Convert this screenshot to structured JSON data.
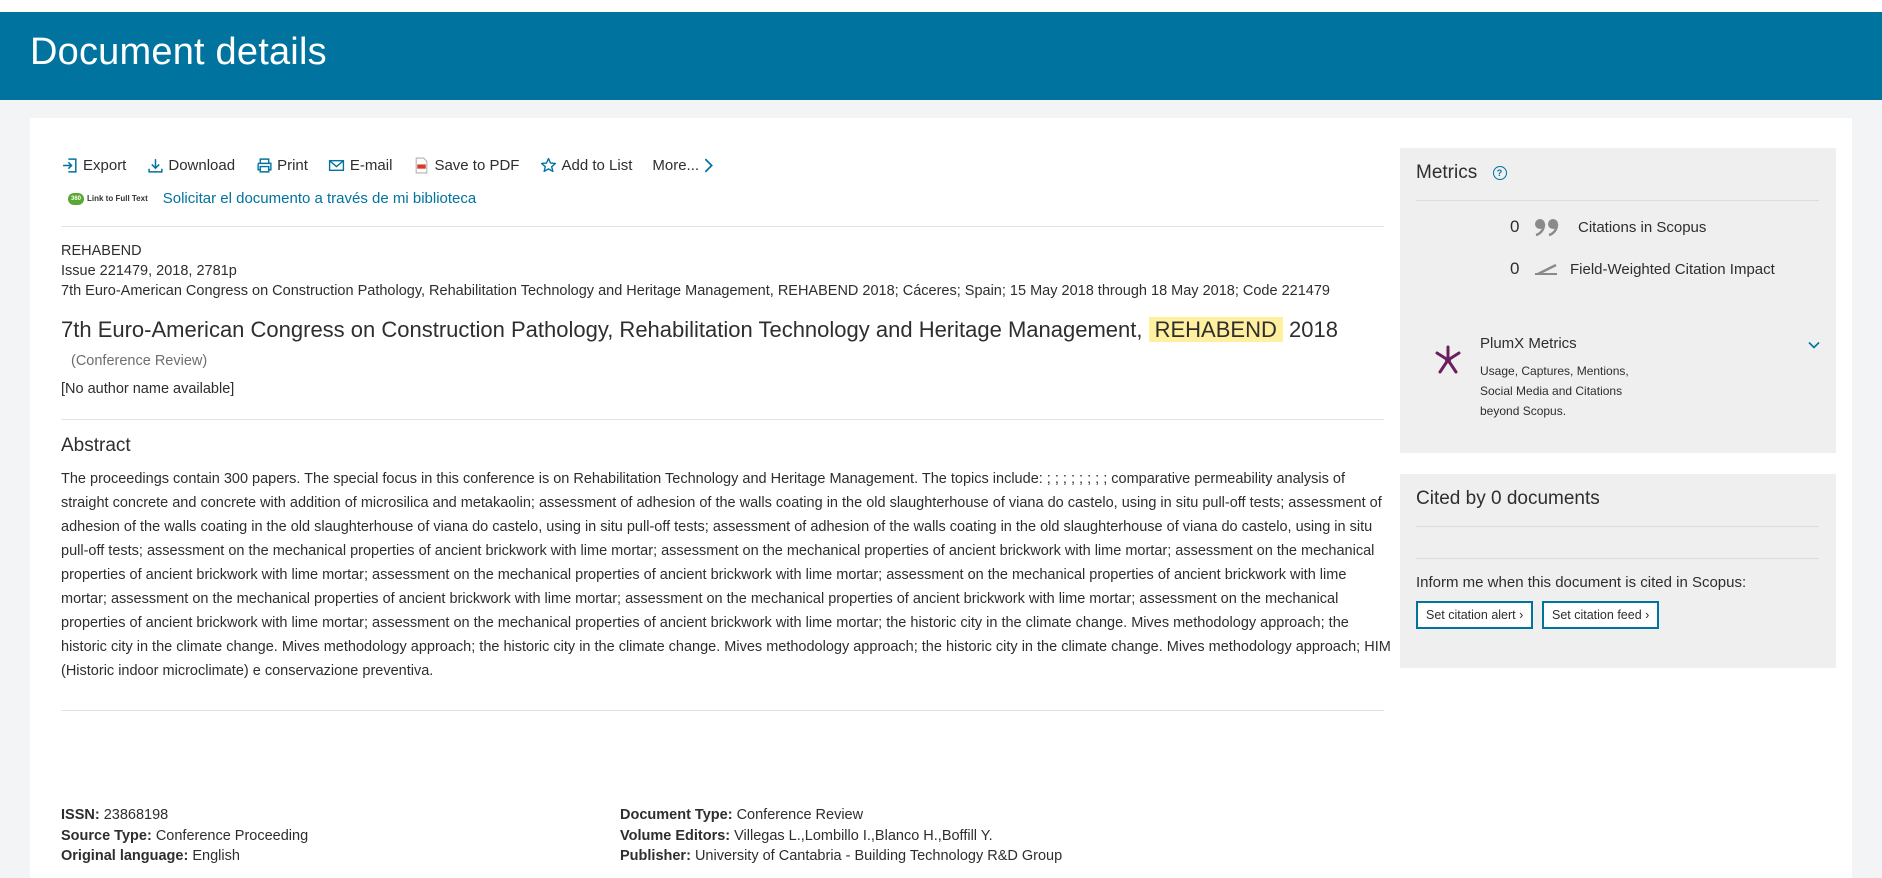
{
  "header": {
    "title": "Document details"
  },
  "toolbar": {
    "export": "Export",
    "download": "Download",
    "print": "Print",
    "email": "E-mail",
    "save_pdf": "Save to PDF",
    "add_list": "Add to List",
    "more": "More..."
  },
  "fulltext": {
    "logo_badge": "360",
    "logo_text": "Link to Full Text",
    "library_link": "Solicitar el documento a través de mi biblioteca"
  },
  "source": {
    "name": "REHABEND",
    "issue": "Issue 221479, 2018, 2781p",
    "conference": "7th Euro-American Congress on Construction Pathology, Rehabilitation Technology and Heritage Management, REHABEND 2018; Cáceres; Spain; 15 May 2018 through 18 May 2018; Code 221479"
  },
  "document": {
    "title_main": "7th Euro-American Congress on Construction Pathology, Rehabilitation Technology and Heritage Management,",
    "title_highlight": "REHABEND",
    "title_year": "2018",
    "type_tag": "(Conference Review)",
    "authors": "[No author name available]"
  },
  "abstract": {
    "heading": "Abstract",
    "text": "The proceedings contain 300 papers. The special focus in this conference is on Rehabilitation Technology and Heritage Management. The topics include: ; ; ; ; ; ; ; ; comparative permeability analysis of straight concrete and concrete with addition of microsilica and metakaolin; assessment of adhesion of the walls coating in the old slaughterhouse of viana do castelo, using in situ pull-off tests; assessment of adhesion of the walls coating in the old slaughterhouse of viana do castelo, using in situ pull-off tests; assessment of adhesion of the walls coating in the old slaughterhouse of viana do castelo, using in situ pull-off tests; assessment on the mechanical properties of ancient brickwork with lime mortar; assessment on the mechanical properties of ancient brickwork with lime mortar; assessment on the mechanical properties of ancient brickwork with lime mortar; assessment on the mechanical properties of ancient brickwork with lime mortar; assessment on the mechanical properties of ancient brickwork with lime mortar; assessment on the mechanical properties of ancient brickwork with lime mortar; assessment on the mechanical properties of ancient brickwork with lime mortar; assessment on the mechanical properties of ancient brickwork with lime mortar; assessment on the mechanical properties of ancient brickwork with lime mortar; the historic city in the climate change. Mives methodology approach; the historic city in the climate change. Mives methodology approach; the historic city in the climate change. Mives methodology approach; the historic city in the climate change. Mives methodology approach; HIM (Historic indoor microclimate) e conservazione preventiva."
  },
  "biblio": {
    "issn_label": "ISSN:",
    "issn": "23868198",
    "source_type_label": "Source Type:",
    "source_type": "Conference Proceeding",
    "language_label": "Original language:",
    "language": "English",
    "doc_type_label": "Document Type:",
    "doc_type": "Conference Review",
    "editors_label": "Volume Editors:",
    "editors": "Villegas L.,Lombillo I.,Blanco H.,Boffill Y.",
    "publisher_label": "Publisher:",
    "publisher": "University of Cantabria - Building Technology R&D Group"
  },
  "metrics": {
    "title": "Metrics",
    "help": "?",
    "citations_value": "0",
    "citations_label": "Citations in Scopus",
    "fwci_value": "0",
    "fwci_label": "Field-Weighted Citation Impact",
    "plumx_title": "PlumX Metrics",
    "plumx_desc": "Usage, Captures, Mentions, Social Media and Citations beyond Scopus."
  },
  "cited": {
    "title": "Cited by 0 documents",
    "prompt": "Inform me when this document is cited in Scopus:",
    "alert_btn": "Set citation alert ›",
    "feed_btn": "Set citation feed ›"
  },
  "colors": {
    "brand": "#00739e",
    "highlight": "#fff0a0",
    "plumx": "#6b1e5e"
  }
}
